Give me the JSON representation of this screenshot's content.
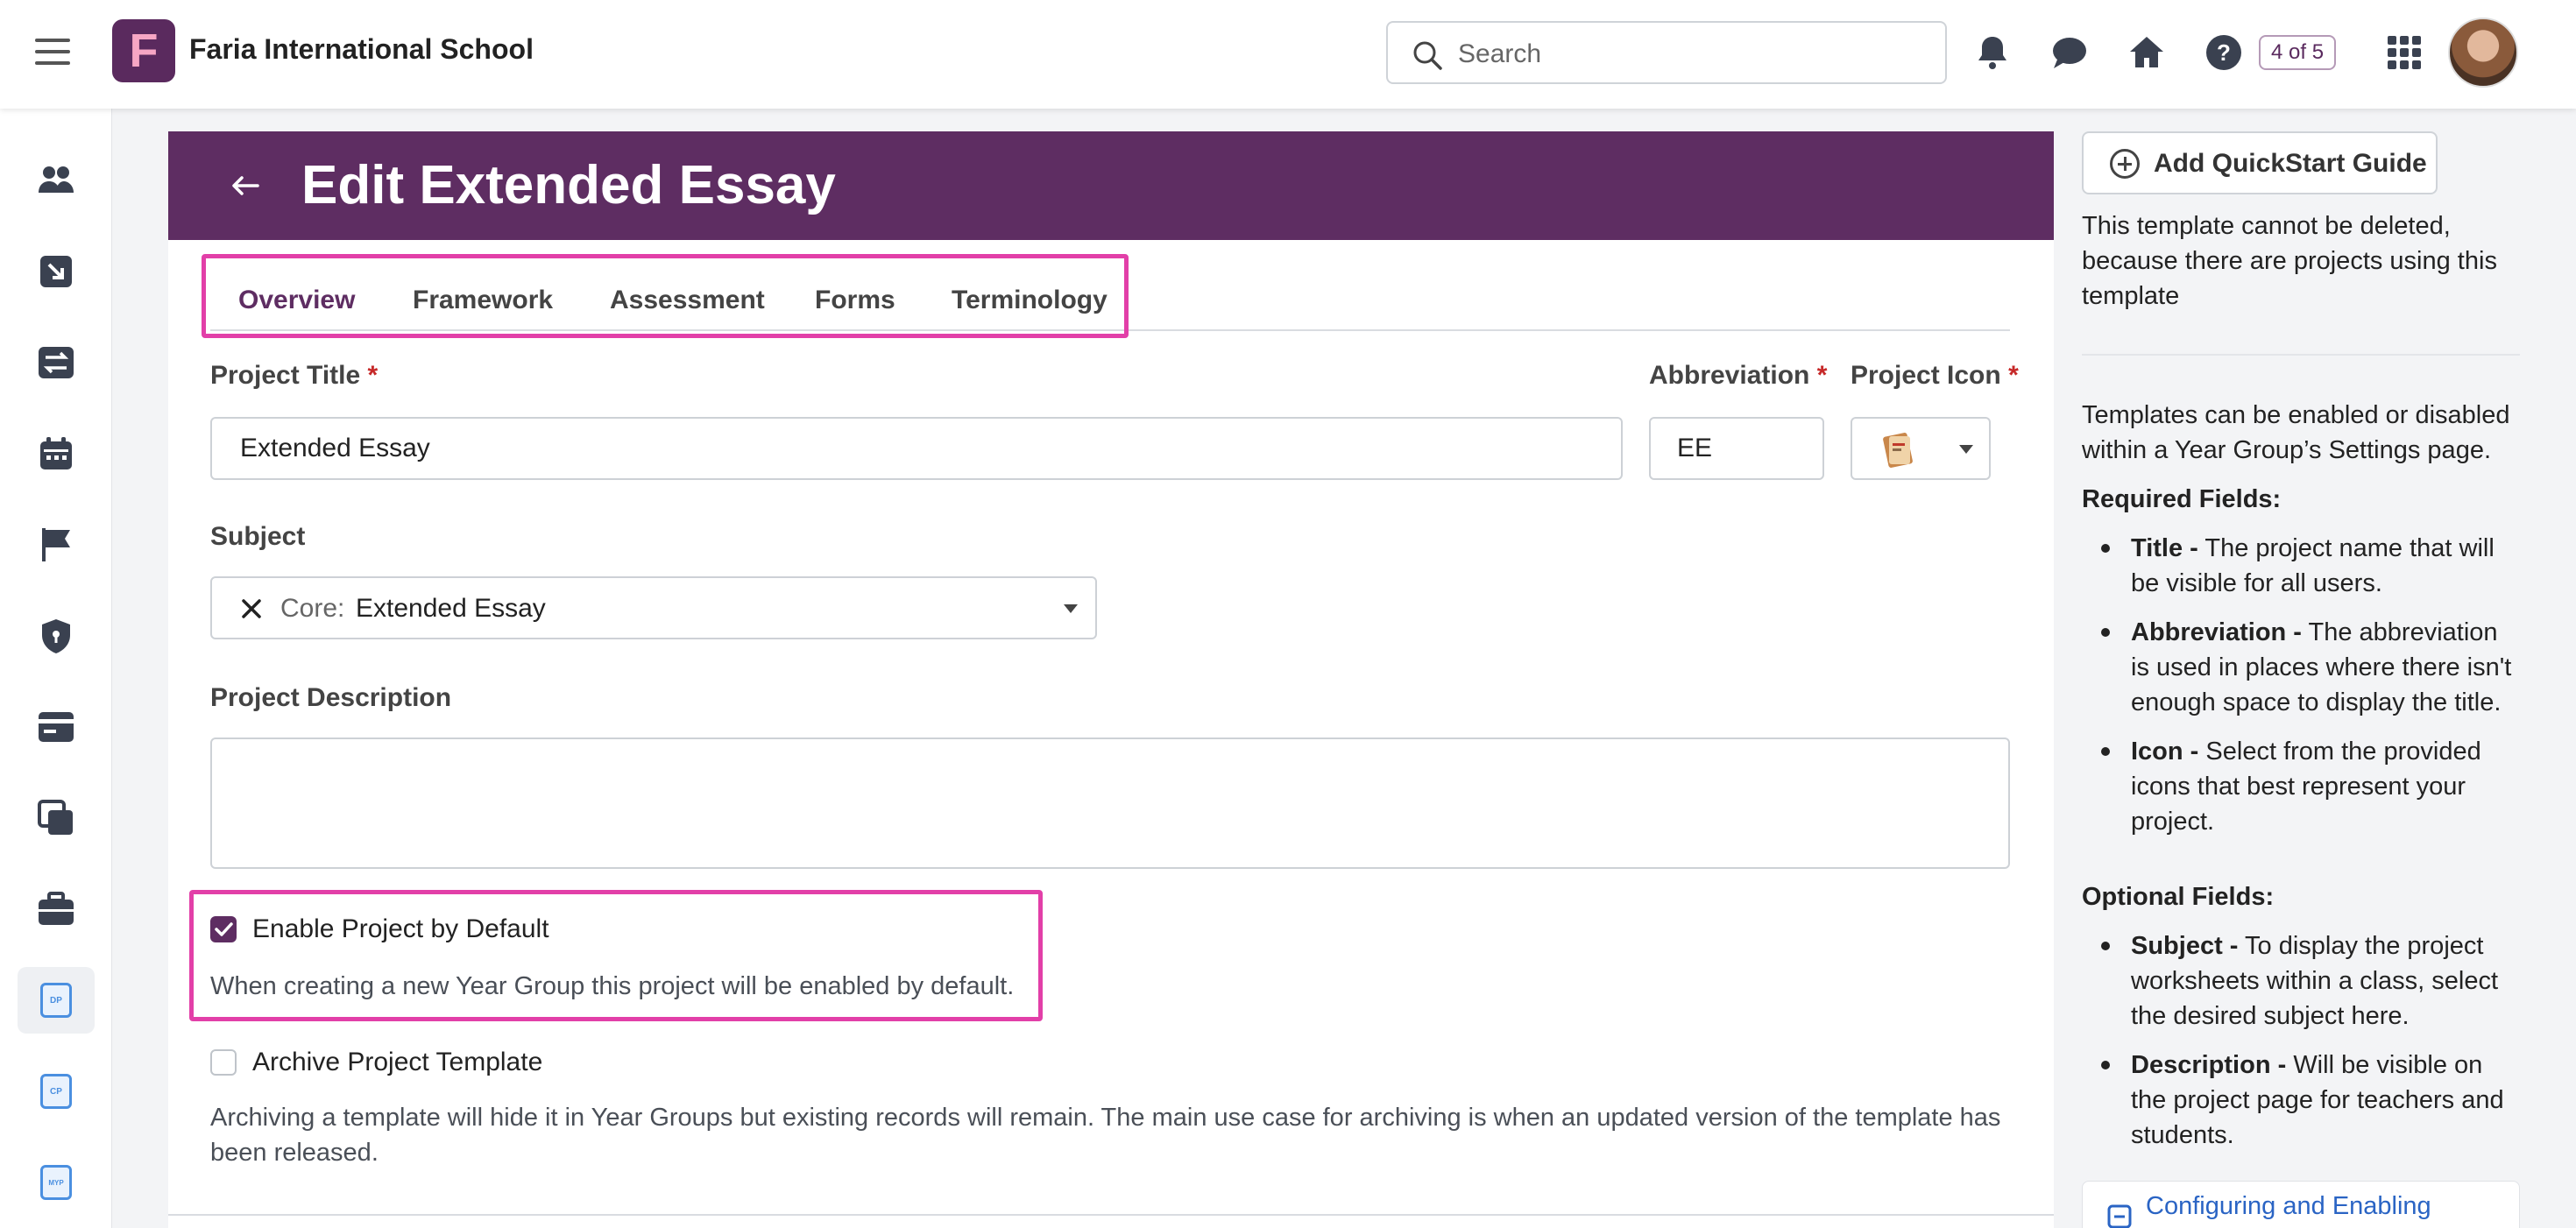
{
  "topbar": {
    "school_name": "Faria International School",
    "logo_letter": "F",
    "search_placeholder": "Search",
    "help_counter": "4 of 5"
  },
  "colors": {
    "brand": "#5e2d62",
    "highlight": "#e23fa8",
    "link": "#2a64c4",
    "required": "#c62828"
  },
  "leftrail": {
    "items": [
      "people-icon",
      "import-icon",
      "transfer-icon",
      "calendar-icon",
      "flag-icon",
      "shield-icon",
      "card-icon",
      "copy-icon",
      "briefcase-icon",
      "dp-icon",
      "cp-icon",
      "myp-icon"
    ],
    "doc_labels": [
      "DP",
      "CP",
      "MYP"
    ]
  },
  "page": {
    "title": "Edit Extended Essay",
    "tabs": [
      {
        "label": "Overview",
        "active": true
      },
      {
        "label": "Framework",
        "active": false
      },
      {
        "label": "Assessment",
        "active": false
      },
      {
        "label": "Forms",
        "active": false
      },
      {
        "label": "Terminology",
        "active": false
      }
    ],
    "fields": {
      "project_title": {
        "label": "Project Title",
        "value": "Extended Essay"
      },
      "abbreviation": {
        "label": "Abbreviation",
        "value": "EE"
      },
      "project_icon": {
        "label": "Project Icon"
      },
      "required_mark": "*",
      "subject": {
        "label": "Subject",
        "prefix": "Core:",
        "value": "Extended Essay"
      },
      "description": {
        "label": "Project Description",
        "value": ""
      }
    },
    "enable_default": {
      "label": "Enable Project by Default",
      "checked": true,
      "help": "When creating a new Year Group this project will be enabled by default."
    },
    "archive": {
      "label": "Archive Project Template",
      "checked": false,
      "help": "Archiving a template will hide it in Year Groups but existing records will remain. The main use case for archiving is when an updated version of the template has been released."
    }
  },
  "sidebar": {
    "quickstart_label": "Add QuickStart Guide",
    "cannot_delete": "This template cannot be deleted, because there are projects using this template",
    "enable_info": "Templates can be enabled or disabled within a Year Group’s Settings page.",
    "required_heading": "Required Fields:",
    "required_items": [
      {
        "term": "Title -",
        "desc": "The project name that will be visible for all users."
      },
      {
        "term": "Abbreviation -",
        "desc": "The abbreviation is used in places where there isn't enough space to display the title."
      },
      {
        "term": "Icon -",
        "desc": "Select from the provided icons that best represent your project."
      }
    ],
    "optional_heading": "Optional Fields:",
    "optional_items": [
      {
        "term": "Subject -",
        "desc": "To display the project worksheets within a class, select the desired subject here."
      },
      {
        "term": "Description -",
        "desc": "Will be visible on the project page for teachers and students."
      }
    ],
    "config_link": "Configuring and Enabling"
  }
}
